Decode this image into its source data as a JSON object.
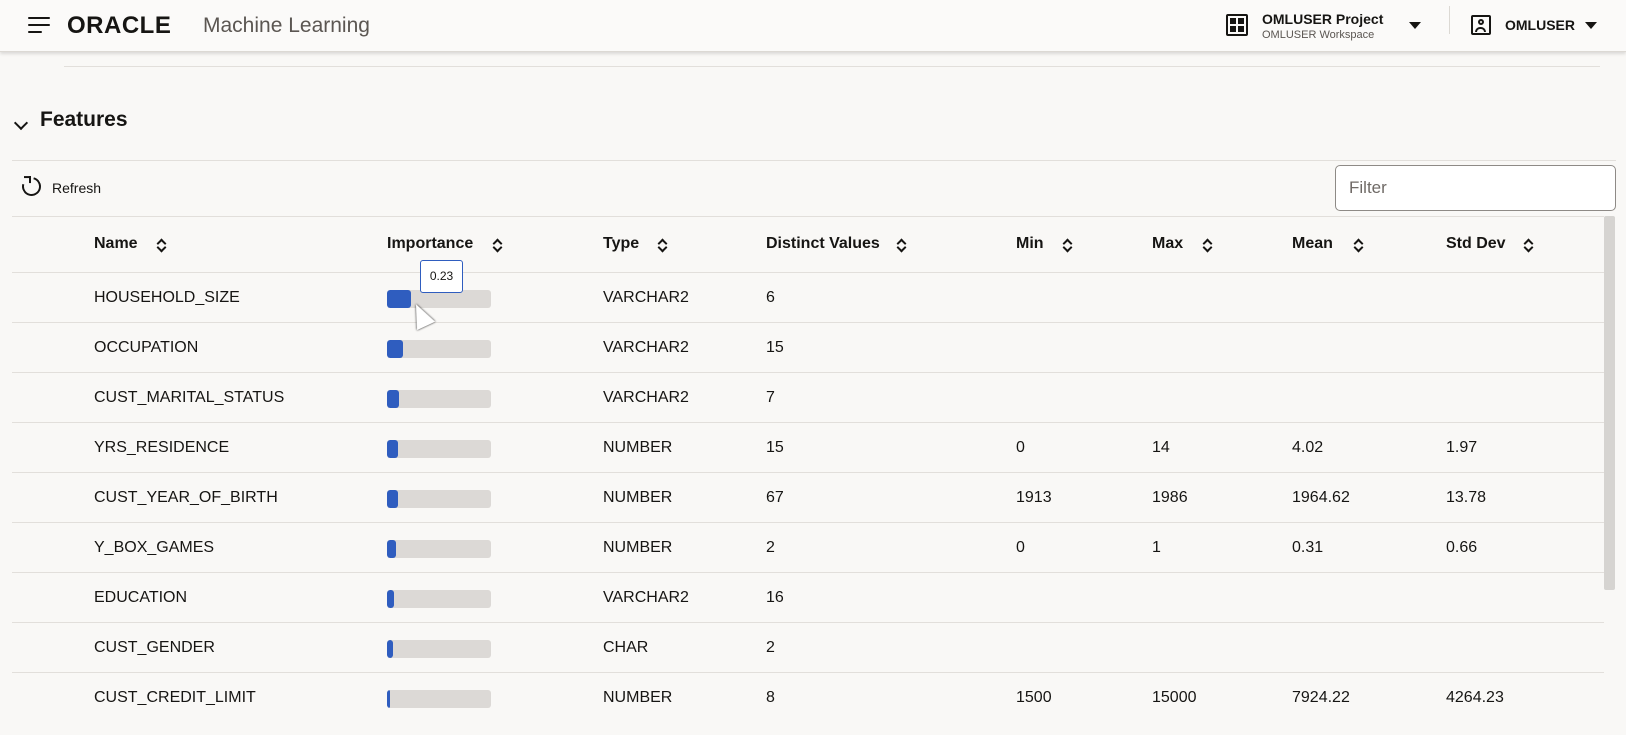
{
  "header": {
    "logo": "ORACLE",
    "app_name": "Machine Learning",
    "project_title": "OMLUSER Project",
    "project_workspace": "OMLUSER Workspace",
    "user": "OMLUSER"
  },
  "section": {
    "title": "Features",
    "refresh_label": "Refresh",
    "filter_placeholder": "Filter"
  },
  "table": {
    "columns": [
      "Name",
      "Importance",
      "Type",
      "Distinct Values",
      "Min",
      "Max",
      "Mean",
      "Std Dev"
    ],
    "rows": [
      {
        "name": "HOUSEHOLD_SIZE",
        "importance": 0.23,
        "type": "VARCHAR2",
        "distinct": "6",
        "min": "",
        "max": "",
        "mean": "",
        "std": ""
      },
      {
        "name": "OCCUPATION",
        "importance": 0.15,
        "type": "VARCHAR2",
        "distinct": "15",
        "min": "",
        "max": "",
        "mean": "",
        "std": ""
      },
      {
        "name": "CUST_MARITAL_STATUS",
        "importance": 0.12,
        "type": "VARCHAR2",
        "distinct": "7",
        "min": "",
        "max": "",
        "mean": "",
        "std": ""
      },
      {
        "name": "YRS_RESIDENCE",
        "importance": 0.11,
        "type": "NUMBER",
        "distinct": "15",
        "min": "0",
        "max": "14",
        "mean": "4.02",
        "std": "1.97"
      },
      {
        "name": "CUST_YEAR_OF_BIRTH",
        "importance": 0.11,
        "type": "NUMBER",
        "distinct": "67",
        "min": "1913",
        "max": "1986",
        "mean": "1964.62",
        "std": "13.78"
      },
      {
        "name": "Y_BOX_GAMES",
        "importance": 0.09,
        "type": "NUMBER",
        "distinct": "2",
        "min": "0",
        "max": "1",
        "mean": "0.31",
        "std": "0.66"
      },
      {
        "name": "EDUCATION",
        "importance": 0.07,
        "type": "VARCHAR2",
        "distinct": "16",
        "min": "",
        "max": "",
        "mean": "",
        "std": ""
      },
      {
        "name": "CUST_GENDER",
        "importance": 0.06,
        "type": "CHAR",
        "distinct": "2",
        "min": "",
        "max": "",
        "mean": "",
        "std": ""
      },
      {
        "name": "CUST_CREDIT_LIMIT",
        "importance": 0.03,
        "type": "NUMBER",
        "distinct": "8",
        "min": "1500",
        "max": "15000",
        "mean": "7924.22",
        "std": "4264.23"
      }
    ]
  },
  "tooltip": {
    "text": "0.23"
  },
  "colors": {
    "accent": "#2f5dbf",
    "bar_track": "#dcd9d6"
  }
}
